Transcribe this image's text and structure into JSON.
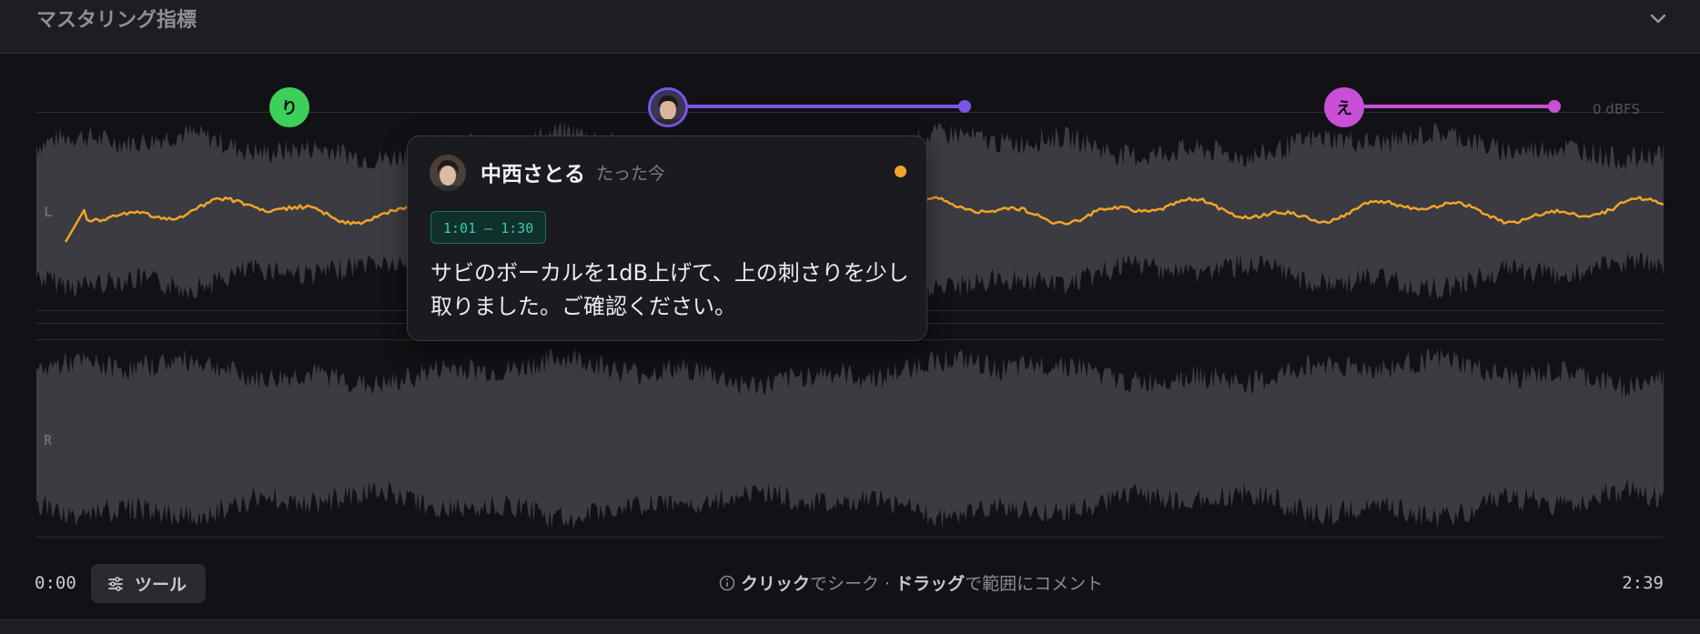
{
  "header": {
    "title": "マスタリング指標"
  },
  "axis": {
    "zero_label": "0 dBFS"
  },
  "channels": {
    "left": "L",
    "right": "R"
  },
  "markers": [
    {
      "label": "り",
      "color": "#3ecf5a"
    },
    {
      "label": "avatar",
      "color": "#7b55e8"
    },
    {
      "label": "え",
      "color": "#c94fd8"
    }
  ],
  "comment": {
    "author": "中西さとる",
    "time": "たった今",
    "range": "1:01 – 1:30",
    "body": "サビのボーカルを1dB上げて、上の刺さりを少し取りました。ご確認ください。",
    "status_color": "#f0a42a"
  },
  "footer": {
    "start_time": "0:00",
    "end_time": "2:39",
    "tool_label": "ツール",
    "hint_click": "クリック",
    "hint_seek": "でシーク · ",
    "hint_drag": "ドラッグ",
    "hint_range": "で範囲にコメント"
  },
  "colors": {
    "loudness": "#f0a42a",
    "wave": "#3b3b41",
    "background": "#121216"
  }
}
